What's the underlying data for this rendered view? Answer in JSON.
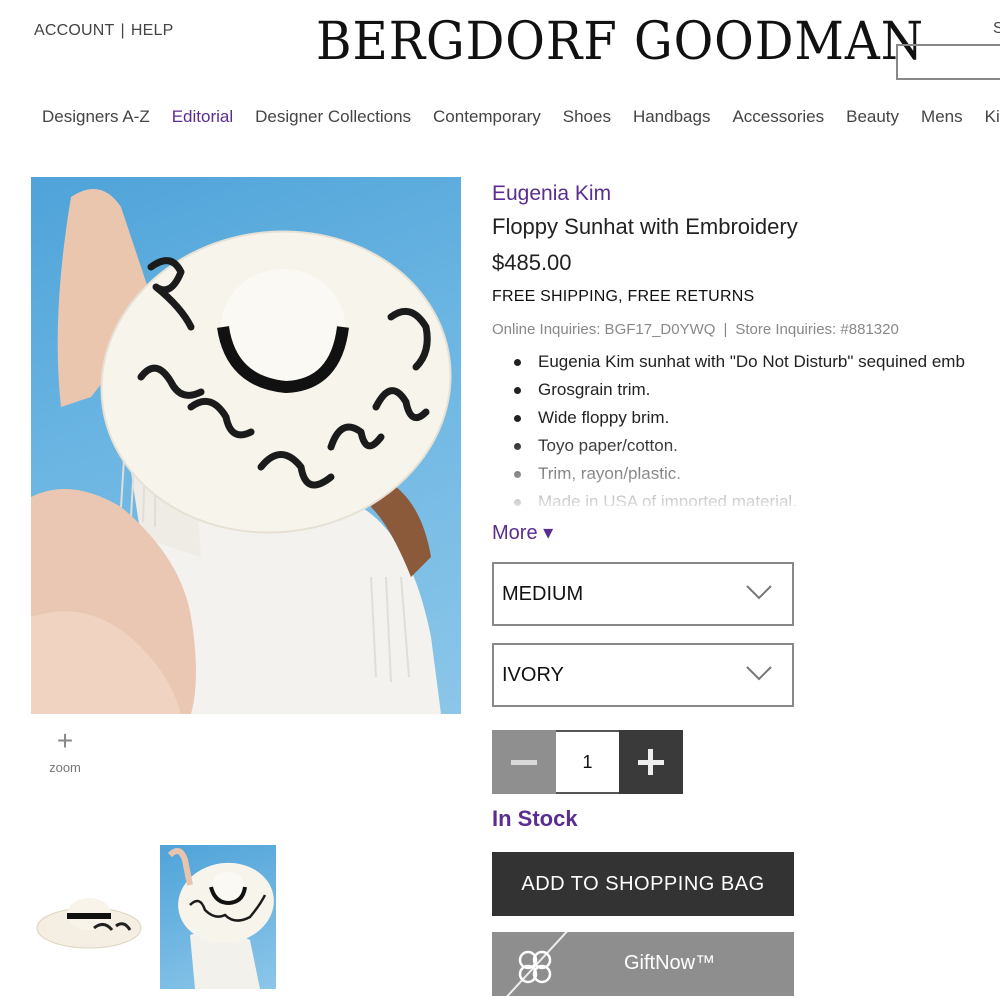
{
  "header": {
    "account_label": "ACCOUNT",
    "help_label": "HELP",
    "separator": "|",
    "logo_text": "BERGDORF GOODMAN",
    "search_partial": "S"
  },
  "nav": {
    "items": [
      {
        "label": "Designers A-Z"
      },
      {
        "label": "Editorial",
        "active": true
      },
      {
        "label": "Designer Collections"
      },
      {
        "label": "Contemporary"
      },
      {
        "label": "Shoes"
      },
      {
        "label": "Handbags"
      },
      {
        "label": "Accessories"
      },
      {
        "label": "Beauty"
      },
      {
        "label": "Mens"
      },
      {
        "label": "Ki"
      }
    ]
  },
  "gallery": {
    "zoom_label": "zoom"
  },
  "product": {
    "brand": "Eugenia Kim",
    "name": "Floppy Sunhat with Embroidery",
    "price": "$485.00",
    "shipping": "FREE SHIPPING, FREE RETURNS",
    "online_inquiries": "Online Inquiries: BGF17_D0YWQ",
    "store_inquiries": "Store Inquiries: #881320",
    "inquiry_divider": "|",
    "bullets": [
      "Eugenia Kim sunhat with \"Do Not Disturb\" sequined emb",
      "Grosgrain trim.",
      "Wide floppy brim.",
      "Toyo paper/cotton.",
      "Trim, rayon/plastic.",
      "Made in USA of imported material."
    ],
    "more_label": "More ▾",
    "size_value": "MEDIUM",
    "color_value": "IVORY",
    "quantity": "1",
    "stock_status": "In Stock",
    "add_to_bag_label": "ADD TO SHOPPING BAG",
    "giftnow_label": "GiftNow™"
  },
  "colors": {
    "accent_purple": "#5a2d91",
    "button_dark": "#333333",
    "button_gray": "#8e8e8e"
  }
}
